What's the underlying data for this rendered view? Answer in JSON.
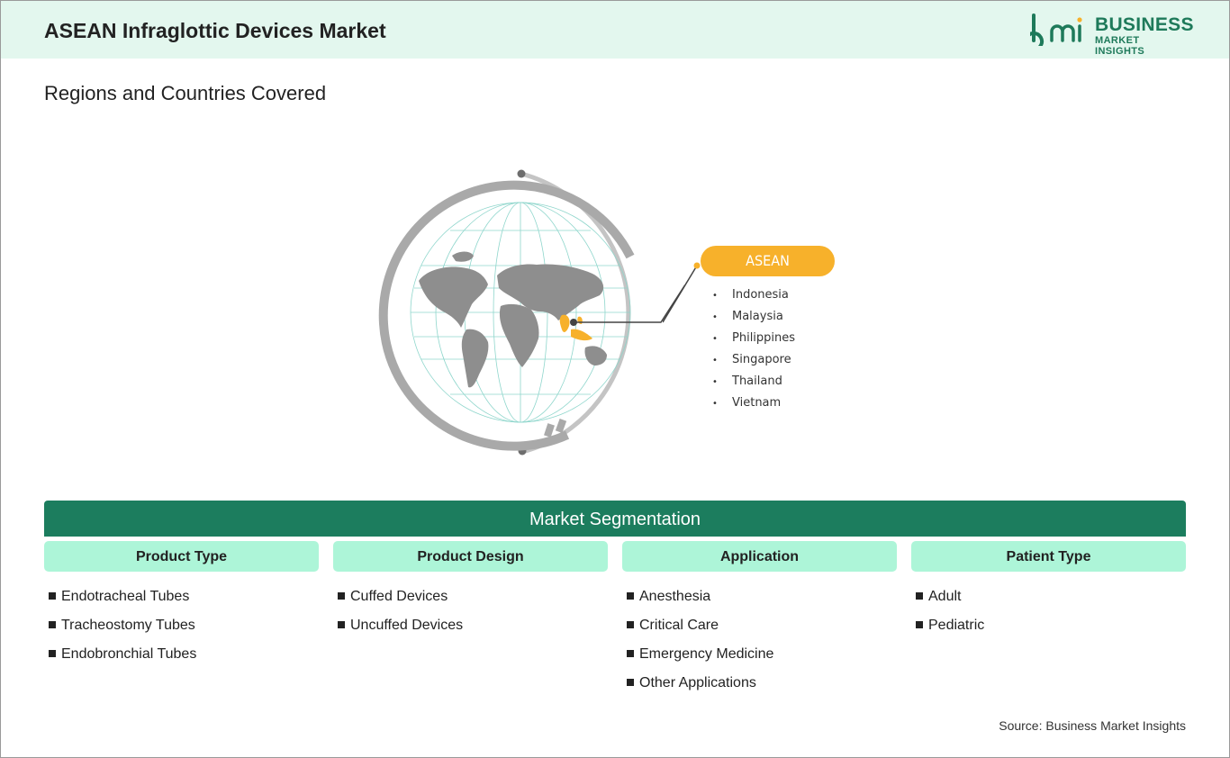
{
  "header": {
    "title": "ASEAN Infraglottic Devices Market",
    "logo_line1": "BUSINESS",
    "logo_line2": "MARKET INSIGHTS"
  },
  "subtitle": "Regions and Countries Covered",
  "region": {
    "name": "ASEAN",
    "countries": [
      "Indonesia",
      "Malaysia",
      "Philippines",
      "Singapore",
      "Thailand",
      "Vietnam"
    ]
  },
  "segmentation": {
    "title": "Market Segmentation",
    "columns": [
      {
        "header": "Product Type",
        "items": [
          "Endotracheal Tubes",
          "Tracheostomy Tubes",
          "Endobronchial Tubes"
        ]
      },
      {
        "header": "Product Design",
        "items": [
          "Cuffed Devices",
          "Uncuffed Devices"
        ]
      },
      {
        "header": "Application",
        "items": [
          "Anesthesia",
          "Critical Care",
          "Emergency Medicine",
          "Other Applications"
        ]
      },
      {
        "header": "Patient Type",
        "items": [
          "Adult",
          "Pediatric"
        ]
      }
    ]
  },
  "source": "Source: Business Market Insights",
  "colors": {
    "header_bg": "#e3f7ee",
    "brand_green": "#1e7a5a",
    "segment_bar": "#1c7d5e",
    "segment_header": "#adf5d8",
    "region_pill": "#f7b12b"
  }
}
